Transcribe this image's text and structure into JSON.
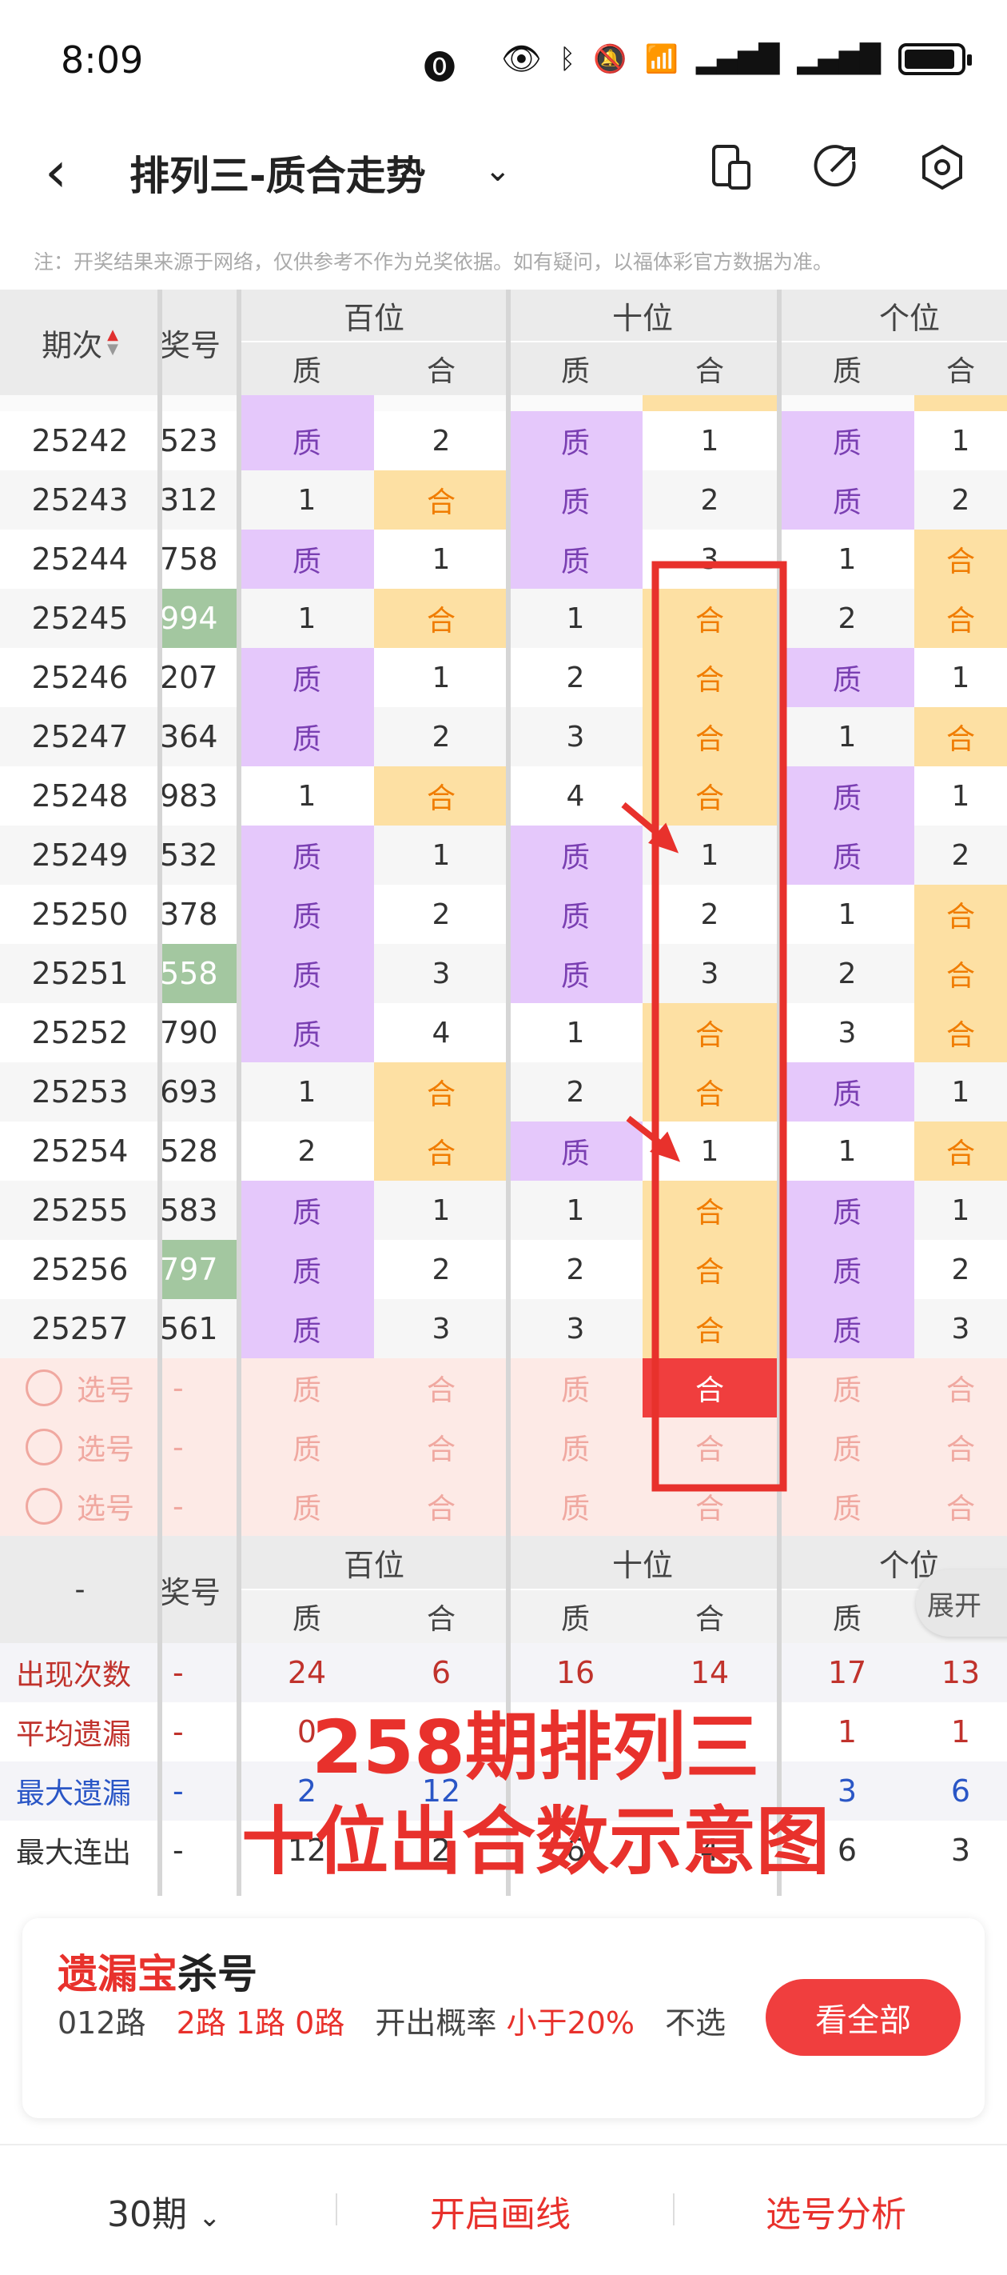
{
  "status_bar": {
    "time": "8:09"
  },
  "nav": {
    "title": "排列三-质合走势"
  },
  "notice": "注：开奖结果来源于网络，仅供参考不作为兑奖依据。如有疑问，以福体彩官方数据为准。",
  "table": {
    "header": {
      "qici": "期次",
      "kaijiang": "奖号",
      "groups": [
        "百位",
        "十位",
        "个位"
      ],
      "sub": [
        "质",
        "合",
        "质",
        "合",
        "质",
        "合"
      ]
    },
    "rows": [
      {
        "period": "25242",
        "num": "523",
        "green": false,
        "cells": [
          [
            "质",
            "zhi"
          ],
          [
            "2",
            ""
          ],
          [
            "质",
            "zhi"
          ],
          [
            "1",
            ""
          ],
          [
            "质",
            "zhi"
          ],
          [
            "1",
            ""
          ]
        ]
      },
      {
        "period": "25243",
        "num": "312",
        "green": false,
        "cells": [
          [
            "1",
            ""
          ],
          [
            "合",
            "he"
          ],
          [
            "质",
            "zhi"
          ],
          [
            "2",
            ""
          ],
          [
            "质",
            "zhi"
          ],
          [
            "2",
            ""
          ]
        ]
      },
      {
        "period": "25244",
        "num": "758",
        "green": false,
        "cells": [
          [
            "质",
            "zhi"
          ],
          [
            "1",
            ""
          ],
          [
            "质",
            "zhi"
          ],
          [
            "3",
            ""
          ],
          [
            "1",
            ""
          ],
          [
            "合",
            "he"
          ]
        ]
      },
      {
        "period": "25245",
        "num": "994",
        "green": true,
        "cells": [
          [
            "1",
            ""
          ],
          [
            "合",
            "he"
          ],
          [
            "1",
            ""
          ],
          [
            "合",
            "he"
          ],
          [
            "2",
            ""
          ],
          [
            "合",
            "he"
          ]
        ]
      },
      {
        "period": "25246",
        "num": "207",
        "green": false,
        "cells": [
          [
            "质",
            "zhi"
          ],
          [
            "1",
            ""
          ],
          [
            "2",
            ""
          ],
          [
            "合",
            "he"
          ],
          [
            "质",
            "zhi"
          ],
          [
            "1",
            ""
          ]
        ]
      },
      {
        "period": "25247",
        "num": "364",
        "green": false,
        "cells": [
          [
            "质",
            "zhi"
          ],
          [
            "2",
            ""
          ],
          [
            "3",
            ""
          ],
          [
            "合",
            "he"
          ],
          [
            "1",
            ""
          ],
          [
            "合",
            "he"
          ]
        ]
      },
      {
        "period": "25248",
        "num": "983",
        "green": false,
        "cells": [
          [
            "1",
            ""
          ],
          [
            "合",
            "he"
          ],
          [
            "4",
            ""
          ],
          [
            "合",
            "he"
          ],
          [
            "质",
            "zhi"
          ],
          [
            "1",
            ""
          ]
        ]
      },
      {
        "period": "25249",
        "num": "532",
        "green": false,
        "cells": [
          [
            "质",
            "zhi"
          ],
          [
            "1",
            ""
          ],
          [
            "质",
            "zhi"
          ],
          [
            "1",
            ""
          ],
          [
            "质",
            "zhi"
          ],
          [
            "2",
            ""
          ]
        ]
      },
      {
        "period": "25250",
        "num": "378",
        "green": false,
        "cells": [
          [
            "质",
            "zhi"
          ],
          [
            "2",
            ""
          ],
          [
            "质",
            "zhi"
          ],
          [
            "2",
            ""
          ],
          [
            "1",
            ""
          ],
          [
            "合",
            "he"
          ]
        ]
      },
      {
        "period": "25251",
        "num": "558",
        "green": true,
        "cells": [
          [
            "质",
            "zhi"
          ],
          [
            "3",
            ""
          ],
          [
            "质",
            "zhi"
          ],
          [
            "3",
            ""
          ],
          [
            "2",
            ""
          ],
          [
            "合",
            "he"
          ]
        ]
      },
      {
        "period": "25252",
        "num": "790",
        "green": false,
        "cells": [
          [
            "质",
            "zhi"
          ],
          [
            "4",
            ""
          ],
          [
            "1",
            ""
          ],
          [
            "合",
            "he"
          ],
          [
            "3",
            ""
          ],
          [
            "合",
            "he"
          ]
        ]
      },
      {
        "period": "25253",
        "num": "693",
        "green": false,
        "cells": [
          [
            "1",
            ""
          ],
          [
            "合",
            "he"
          ],
          [
            "2",
            ""
          ],
          [
            "合",
            "he"
          ],
          [
            "质",
            "zhi"
          ],
          [
            "1",
            ""
          ]
        ]
      },
      {
        "period": "25254",
        "num": "528",
        "green": false,
        "cells": [
          [
            "2",
            ""
          ],
          [
            "合",
            "he"
          ],
          [
            "质",
            "zhi"
          ],
          [
            "1",
            ""
          ],
          [
            "1",
            ""
          ],
          [
            "合",
            "he"
          ]
        ]
      },
      {
        "period": "25255",
        "num": "583",
        "green": false,
        "cells": [
          [
            "质",
            "zhi"
          ],
          [
            "1",
            ""
          ],
          [
            "1",
            ""
          ],
          [
            "合",
            "he"
          ],
          [
            "质",
            "zhi"
          ],
          [
            "1",
            ""
          ]
        ]
      },
      {
        "period": "25256",
        "num": "797",
        "green": true,
        "cells": [
          [
            "质",
            "zhi"
          ],
          [
            "2",
            ""
          ],
          [
            "2",
            ""
          ],
          [
            "合",
            "he"
          ],
          [
            "质",
            "zhi"
          ],
          [
            "2",
            ""
          ]
        ]
      },
      {
        "period": "25257",
        "num": "561",
        "green": false,
        "cells": [
          [
            "质",
            "zhi"
          ],
          [
            "3",
            ""
          ],
          [
            "3",
            ""
          ],
          [
            "合",
            "he"
          ],
          [
            "质",
            "zhi"
          ],
          [
            "3",
            ""
          ]
        ]
      }
    ],
    "pick_rows": [
      {
        "label": "选号",
        "dash": "-",
        "cells": [
          "质",
          "合",
          "质",
          "合",
          "质",
          "合"
        ],
        "active_index": 3
      },
      {
        "label": "选号",
        "dash": "-",
        "cells": [
          "质",
          "合",
          "质",
          "合",
          "质",
          "合"
        ],
        "active_index": -1
      },
      {
        "label": "选号",
        "dash": "-",
        "cells": [
          "质",
          "合",
          "质",
          "合",
          "质",
          "合"
        ],
        "active_index": -1
      }
    ],
    "stat_header": {
      "dash": "-",
      "kaijiang": "奖号",
      "groups": [
        "百位",
        "十位",
        "个位"
      ],
      "sub": [
        "质",
        "合",
        "质",
        "合",
        "质",
        "合"
      ],
      "expand": "展开"
    },
    "stats": [
      {
        "label": "出现次数",
        "color": "red",
        "dash": "-",
        "values": [
          "24",
          "6",
          "16",
          "14",
          "17",
          "13"
        ]
      },
      {
        "label": "平均遗漏",
        "color": "red",
        "dash": "-",
        "values": [
          "0",
          "",
          "",
          "",
          "1",
          "1"
        ]
      },
      {
        "label": "最大遗漏",
        "color": "blue",
        "dash": "-",
        "values": [
          "2",
          "12",
          "",
          "",
          "3",
          "6"
        ]
      },
      {
        "label": "最大连出",
        "color": "dark",
        "dash": "-",
        "values": [
          "12",
          "2",
          "6",
          "4",
          "6",
          "3"
        ]
      }
    ]
  },
  "overlay": {
    "line1": "258期排列三",
    "line2": "十位出合数示意图",
    "color": "#e8312c"
  },
  "card": {
    "title_red": "遗漏宝",
    "title_dark": "杀号",
    "body_prefix": "012路",
    "body_red1": "2路 1路 0路",
    "body_mid": "开出概率",
    "body_red2": "小于20%",
    "body_suffix": "不选",
    "button": "看全部"
  },
  "bottom_bar": {
    "period": "30期",
    "draw": "开启画线",
    "analysis": "选号分析"
  },
  "colors": {
    "accent": "#f03e3e",
    "zhi_bg": "#e5c8fb",
    "he_bg": "#fde0a3"
  }
}
